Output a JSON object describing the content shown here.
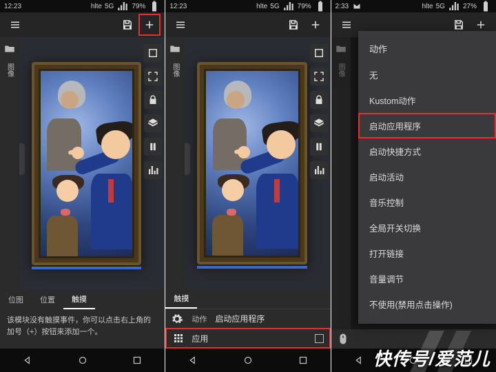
{
  "status": {
    "time1": "12:23",
    "time3": "2:33",
    "net": "5G",
    "bat1": "79%",
    "bat3": "27%",
    "sig": "hlte"
  },
  "icons": {
    "menu": "menu-icon",
    "save": "save-icon",
    "plus": "plus-icon",
    "folder": "folder-icon",
    "image": "image-icon",
    "square": "square-icon",
    "expand": "expand-icon",
    "lock": "lock-icon",
    "layers": "layers-icon",
    "pause": "pause-icon",
    "stats": "stats-icon",
    "mouse": "mouse-icon",
    "gear": "gear-icon",
    "grid": "grid-icon",
    "back": "back-triangle-icon",
    "home": "home-circle-icon",
    "recent": "recent-square-icon",
    "left": "chevron-left-icon"
  },
  "left": {
    "imglabel": "图像"
  },
  "tabs1": {
    "a": "位图",
    "b": "位置",
    "c": "触摸"
  },
  "msg1": "该模块没有触摸事件，你可以点击右上角的加号（+）按钮来添加一个。",
  "tabs2": {
    "a": "触摸"
  },
  "row2a": {
    "icon": "gear-icon",
    "lbl": "动作",
    "val": "启动应用程序"
  },
  "row2b": {
    "icon": "grid-icon",
    "lbl": "应用"
  },
  "menu": {
    "title": "动作",
    "items": [
      "无",
      "Kustom动作",
      "启动应用程序",
      "启动快捷方式",
      "启动活动",
      "音乐控制",
      "全局开关切换",
      "打开链接",
      "音量调节",
      "不使用(禁用点击操作)"
    ],
    "highlight": 2
  },
  "watermark": "快传号/爱范儿"
}
